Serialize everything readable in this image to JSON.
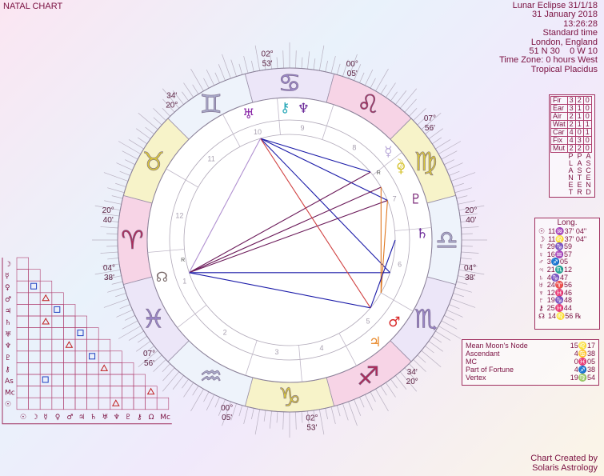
{
  "title": "NATAL CHART",
  "info": {
    "lines": [
      "Lunar Eclipse 31/1/18",
      "31 January 2018",
      "13:26:28",
      "Standard time",
      "London, England",
      "51 N 30    0 W 10",
      "Time Zone: 0 hours West",
      "Tropical Placidus"
    ]
  },
  "credit": {
    "line1": "Chart Created by",
    "line2": "Solaris Astrology"
  },
  "wheel": {
    "signs": [
      "♈",
      "♉",
      "♊",
      "♋",
      "♌",
      "♍",
      "♎",
      "♏",
      "♐",
      "♑",
      "♒",
      "♓"
    ],
    "sign_colors": [
      "#f7d4e6",
      "#f7f3c9",
      "#eef3fb",
      "#ece6f8",
      "#f7d4e6",
      "#f7f3c9",
      "#eef3fb",
      "#ece6f8",
      "#f7d4e6",
      "#f7f3c9",
      "#eef3fb",
      "#ece6f8"
    ],
    "glyph_colors": [
      "#b02858",
      "#d8c63a",
      "#a8a8c8",
      "#9a86c8",
      "#b02858",
      "#d8c63a",
      "#a8a8c8",
      "#9a86c8",
      "#b02858",
      "#d8c63a",
      "#a8a8c8",
      "#9a86c8"
    ],
    "cusp_labels": [
      {
        "deg": "02°",
        "min": "53'"
      },
      {
        "deg": "00°",
        "min": "05'"
      },
      {
        "deg": "07°",
        "min": "56'"
      },
      {
        "deg": "20°",
        "min": "40'"
      },
      {
        "deg": "04°",
        "min": "38'"
      },
      {
        "deg": "34'",
        "min": "20°"
      },
      {
        "deg": "02°",
        "min": "53'"
      },
      {
        "deg": "00°",
        "min": "05'"
      },
      {
        "deg": "07°",
        "min": "56'"
      },
      {
        "deg": "20°",
        "min": "40'"
      },
      {
        "deg": "04°",
        "min": "38'"
      },
      {
        "deg": "34'",
        "min": "20°"
      }
    ],
    "house_numbers": [
      "1",
      "2",
      "3",
      "4",
      "5",
      "6",
      "7",
      "8",
      "9",
      "10",
      "11",
      "12"
    ],
    "planets": [
      {
        "glyph": "♅",
        "color": "#8a28a8"
      },
      {
        "glyph": "⚷",
        "color": "#28a8b8"
      },
      {
        "glyph": "♆",
        "color": "#6a2898"
      },
      {
        "glyph": "☿",
        "color": "#b8a8d8"
      },
      {
        "glyph": "♀",
        "color": "#d8c63a"
      },
      {
        "glyph": "☽",
        "color": "#d8c63a"
      },
      {
        "glyph": "♇",
        "color": "#7a2878"
      },
      {
        "glyph": "♄",
        "color": "#6a2898"
      },
      {
        "glyph": "♂",
        "color": "#d82828"
      },
      {
        "glyph": "♃",
        "color": "#e88828"
      },
      {
        "glyph": "☊",
        "color": "#7a6a6a"
      }
    ],
    "retro_marks": [
      "R",
      "R"
    ]
  },
  "elements": {
    "rows": [
      {
        "label": "Fir",
        "p": "3",
        "a": "2",
        "c": "0"
      },
      {
        "label": "Ear",
        "p": "3",
        "a": "1",
        "c": "0"
      },
      {
        "label": "Air",
        "p": "2",
        "a": "1",
        "c": "0"
      },
      {
        "label": "Wat",
        "p": "2",
        "a": "1",
        "c": "1"
      },
      {
        "label": "Car",
        "p": "4",
        "a": "0",
        "c": "1"
      },
      {
        "label": "Fix",
        "p": "4",
        "a": "3",
        "c": "0"
      },
      {
        "label": "Mut",
        "p": "2",
        "a": "2",
        "c": "0"
      }
    ],
    "col_letters": {
      "p": [
        "P",
        "L",
        "A",
        "N",
        "E",
        "T"
      ],
      "a": [
        "P",
        "A",
        "S",
        "T",
        "E",
        "R"
      ],
      "c": [
        "A",
        "S",
        "C",
        "E",
        "N",
        "D"
      ]
    }
  },
  "longitudes": {
    "header": "Long.",
    "rows": [
      {
        "glyph": "☉",
        "value": "11♒37' 04\""
      },
      {
        "glyph": "☽",
        "value": "11♌37' 04\""
      },
      {
        "glyph": "☿",
        "value": "29♑59"
      },
      {
        "glyph": "♀",
        "value": "16♒57"
      },
      {
        "glyph": "♂",
        "value": "3♐05"
      },
      {
        "glyph": "♃",
        "value": "21♏12"
      },
      {
        "glyph": "♄",
        "value": "4♑47"
      },
      {
        "glyph": "♅",
        "value": "24♈56"
      },
      {
        "glyph": "♆",
        "value": "12♓46"
      },
      {
        "glyph": "♇",
        "value": "19♑48"
      },
      {
        "glyph": "⚷",
        "value": "25♓44"
      },
      {
        "glyph": "☊",
        "value": "14♌56 ℞"
      }
    ]
  },
  "points": [
    {
      "name": "Mean Moon's Node",
      "value": "15♌17"
    },
    {
      "name": "Ascendant",
      "value": "4♋38"
    },
    {
      "name": "MC",
      "value": "0♓05"
    },
    {
      "name": "Part of Fortune",
      "value": "4♐38"
    },
    {
      "name": "Vertex",
      "value": "19♍54"
    }
  ],
  "aspect_grid": {
    "labels": [
      "☽",
      "☿",
      "♀",
      "♂",
      "♃",
      "♄",
      "♅",
      "♆",
      "♇",
      "⚷",
      "As",
      "Mc",
      "☉"
    ],
    "bottom_labels": [
      "☉",
      "☽",
      "☿",
      "♀",
      "♂",
      "♃",
      "♄",
      "♅",
      "♆",
      "♇",
      "⚷",
      "Ω",
      "Mc"
    ]
  }
}
